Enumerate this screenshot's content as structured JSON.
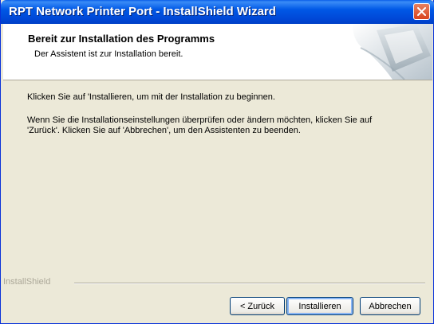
{
  "window": {
    "title": "RPT Network Printer Port - InstallShield Wizard"
  },
  "header": {
    "title": "Bereit zur Installation des Programms",
    "subtitle": "Der Assistent ist zur Installation bereit."
  },
  "body": {
    "line1": "Klicken Sie auf 'Installieren, um mit der Installation zu beginnen.",
    "line2": "Wenn Sie die Installationseinstellungen überprüfen oder ändern möchten, klicken Sie auf",
    "line3": "'Zurück'. Klicken Sie auf 'Abbrechen', um den Assistenten zu beenden."
  },
  "footer": {
    "brand": "InstallShield",
    "back_label": "< Zurück",
    "install_label": "Installieren",
    "cancel_label": "Abbrechen"
  },
  "icons": {
    "close": "close-icon",
    "header_graphic": "computer-graphic-icon"
  },
  "colors": {
    "titlebar": "#0058e6",
    "close_button": "#d9431c",
    "dialog_background": "#ece9d8"
  }
}
